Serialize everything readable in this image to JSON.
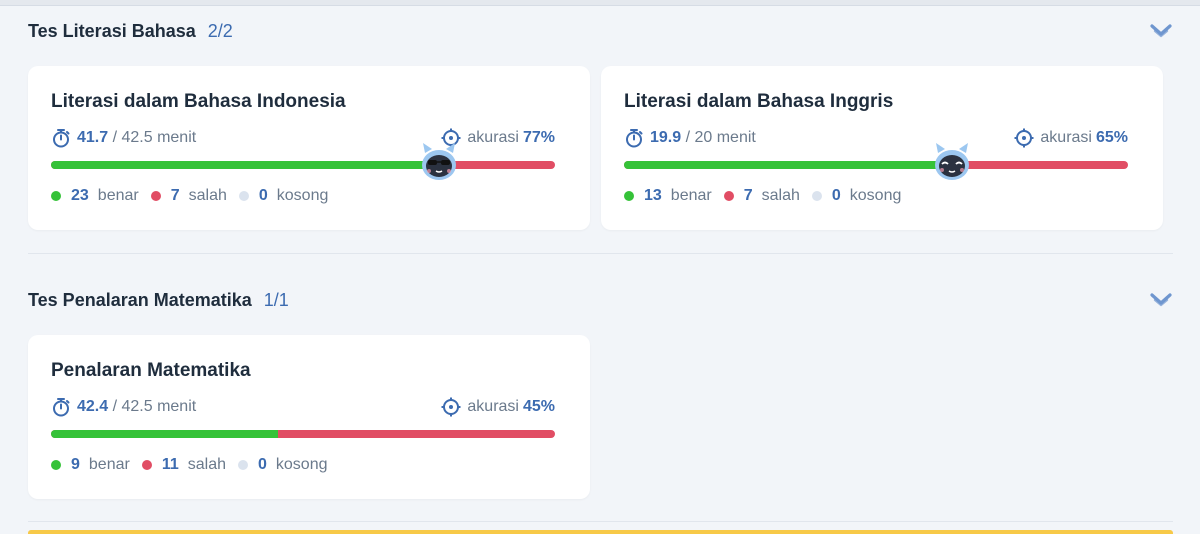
{
  "colors": {
    "accent": "#3c6bb0",
    "correct": "#35c238",
    "wrong": "#e14d64",
    "empty": "#dbe3ee",
    "highlight": "#f7c948"
  },
  "sections": [
    {
      "title": "Tes Literasi Bahasa",
      "count": "2/2",
      "chevron_icon": "chevron-down-icon",
      "cards": [
        {
          "title": "Literasi dalam Bahasa Indonesia",
          "time_used": "41.7",
          "time_total": "/ 42.5 menit",
          "accuracy_label": "akurasi",
          "accuracy": "77%",
          "accuracy_fraction": 0.77,
          "correct": "23",
          "correct_label": "benar",
          "wrong": "7",
          "wrong_label": "salah",
          "empty": "0",
          "empty_label": "kosong"
        },
        {
          "title": "Literasi dalam Bahasa Inggris",
          "time_used": "19.9",
          "time_total": "/ 20 menit",
          "accuracy_label": "akurasi",
          "accuracy": "65%",
          "accuracy_fraction": 0.65,
          "correct": "13",
          "correct_label": "benar",
          "wrong": "7",
          "wrong_label": "salah",
          "empty": "0",
          "empty_label": "kosong"
        }
      ]
    },
    {
      "title": "Tes Penalaran Matematika",
      "count": "1/1",
      "chevron_icon": "chevron-down-icon",
      "cards": [
        {
          "title": "Penalaran Matematika",
          "time_used": "42.4",
          "time_total": "/ 42.5 menit",
          "accuracy_label": "akurasi",
          "accuracy": "45%",
          "accuracy_fraction": 0.45,
          "correct": "9",
          "correct_label": "benar",
          "wrong": "11",
          "wrong_label": "salah",
          "empty": "0",
          "empty_label": "kosong"
        }
      ]
    }
  ]
}
